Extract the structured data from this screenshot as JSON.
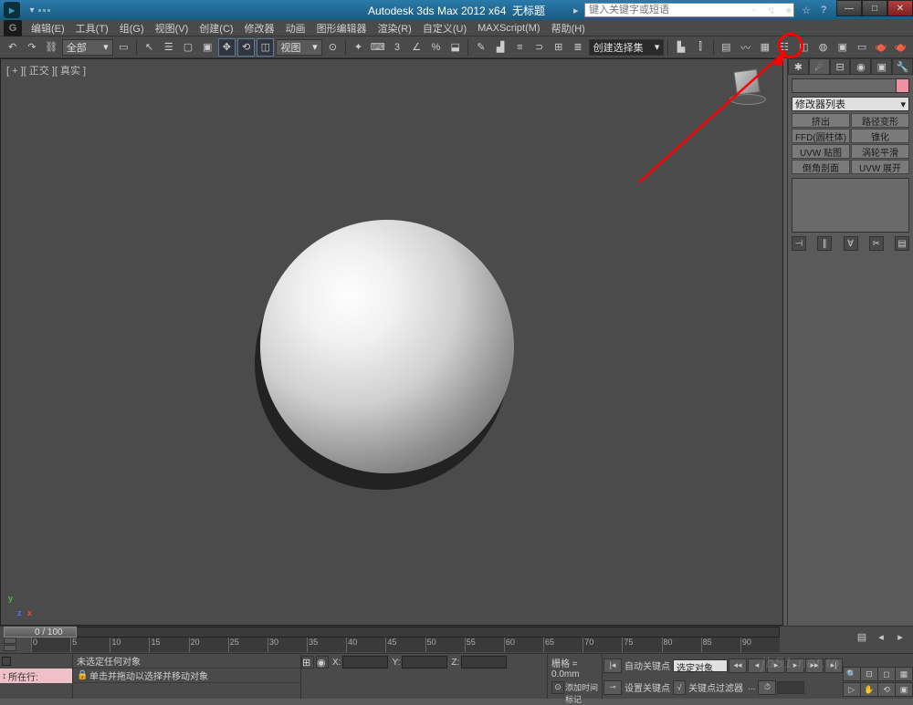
{
  "title": {
    "app": "Autodesk 3ds Max 2012 x64",
    "doc": "无标题",
    "search_placeholder": "键入关键字或短语"
  },
  "menu": {
    "edit": "编辑(E)",
    "tools": "工具(T)",
    "group": "组(G)",
    "views": "视图(V)",
    "create": "创建(C)",
    "modifiers": "修改器",
    "animation": "动画",
    "graph": "图形编辑器",
    "render": "渲染(R)",
    "custom": "自定义(U)",
    "maxscript": "MAXScript(M)",
    "help": "帮助(H)"
  },
  "toolbar": {
    "selection_set": "全部",
    "view_dd": "视图",
    "named_sel": "创建选择集"
  },
  "viewport": {
    "label": "[ + ][ 正交 ][ 真实 ]"
  },
  "modifier_panel": {
    "dropdown": "修改器列表",
    "buttons": {
      "extrude": "挤出",
      "pathdeform": "路径变形",
      "ffd": "FFD(圆柱体)",
      "taper": "锥化",
      "uvwmap": "UVW 贴图",
      "meshsmooth": "涡轮平滑",
      "chamfer": "倒角剖面",
      "uvwunwrap": "UVW 展开"
    }
  },
  "timeline": {
    "counter": "0 / 100",
    "ticks": [
      "0",
      "5",
      "10",
      "15",
      "20",
      "25",
      "30",
      "35",
      "40",
      "45",
      "50",
      "55",
      "60",
      "65",
      "70",
      "75",
      "80",
      "85",
      "90"
    ]
  },
  "status": {
    "locrow_label": "所在行:",
    "msg1": "未选定任何对象",
    "msg2": "单击并拖动以选择并移动对象",
    "hint": "添加时间标记",
    "x": "X:",
    "y": "Y:",
    "z": "Z:",
    "grid": "栅格 = 0.0mm",
    "autokey": "自动关键点",
    "setkey": "设置关键点",
    "sel_obj": "选定对象",
    "filter": "关键点过滤器"
  },
  "watermark": "jb51.net.to"
}
